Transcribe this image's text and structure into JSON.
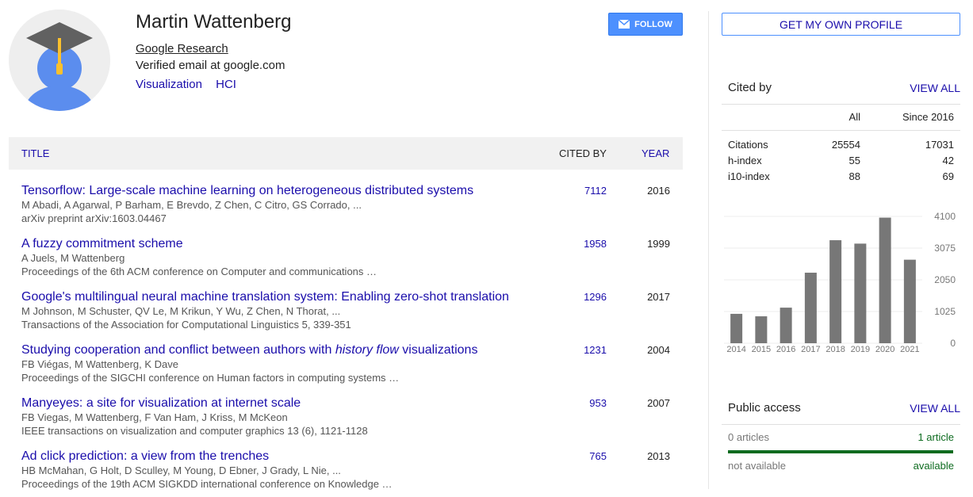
{
  "profile": {
    "name": "Martin Wattenberg",
    "affiliation": "Google Research",
    "email": "Verified email at google.com",
    "interests": [
      "Visualization",
      "HCI"
    ],
    "follow_label": "FOLLOW"
  },
  "table": {
    "headers": {
      "title": "TITLE",
      "cited_by": "CITED BY",
      "year": "YEAR"
    },
    "rows": [
      {
        "title": "Tensorflow: Large-scale machine learning on heterogeneous distributed systems",
        "authors": "M Abadi, A Agarwal, P Barham, E Brevdo, Z Chen, C Citro, GS Corrado, ...",
        "venue": "arXiv preprint arXiv:1603.04467",
        "cited": "7112",
        "year": "2016"
      },
      {
        "title": "A fuzzy commitment scheme",
        "authors": "A Juels, M Wattenberg",
        "venue": "Proceedings of the 6th ACM conference on Computer and communications …",
        "cited": "1958",
        "year": "1999"
      },
      {
        "title": "Google's multilingual neural machine translation system: Enabling zero-shot translation",
        "authors": "M Johnson, M Schuster, QV Le, M Krikun, Y Wu, Z Chen, N Thorat, ...",
        "venue": "Transactions of the Association for Computational Linguistics 5, 339-351",
        "cited": "1296",
        "year": "2017"
      },
      {
        "title_pre": "Studying cooperation and conflict between authors with ",
        "title_em": "history flow",
        "title_post": " visualizations",
        "authors": "FB Viégas, M Wattenberg, K Dave",
        "venue": "Proceedings of the SIGCHI conference on Human factors in computing systems …",
        "cited": "1231",
        "year": "2004"
      },
      {
        "title": "Manyeyes: a site for visualization at internet scale",
        "authors": "FB Viegas, M Wattenberg, F Van Ham, J Kriss, M McKeon",
        "venue": "IEEE transactions on visualization and computer graphics 13 (6), 1121-1128",
        "cited": "953",
        "year": "2007"
      },
      {
        "title": "Ad click prediction: a view from the trenches",
        "authors": "HB McMahan, G Holt, D Sculley, M Young, D Ebner, J Grady, L Nie, ...",
        "venue": "Proceedings of the 19th ACM SIGKDD international conference on Knowledge …",
        "cited": "765",
        "year": "2013"
      }
    ]
  },
  "sidebar": {
    "get_profile": "GET MY OWN PROFILE",
    "cited_by": {
      "title": "Cited by",
      "view_all": "VIEW ALL",
      "col_all": "All",
      "col_since": "Since 2016",
      "stats": [
        {
          "label": "Citations",
          "all": "25554",
          "since": "17031"
        },
        {
          "label": "h-index",
          "all": "55",
          "since": "42"
        },
        {
          "label": "i10-index",
          "all": "88",
          "since": "69"
        }
      ]
    },
    "public_access": {
      "title": "Public access",
      "view_all": "VIEW ALL",
      "left_count": "0 articles",
      "right_count": "1 article",
      "left_status": "not available",
      "right_status": "available"
    }
  },
  "chart_data": {
    "type": "bar",
    "categories": [
      "2014",
      "2015",
      "2016",
      "2017",
      "2018",
      "2019",
      "2020",
      "2021"
    ],
    "values": [
      950,
      870,
      1150,
      2280,
      3330,
      3220,
      4060,
      2700
    ],
    "yticks": [
      "4100",
      "3075",
      "2050",
      "1025",
      "0"
    ],
    "ylim": [
      0,
      4100
    ],
    "bar_color": "#777777"
  },
  "colors": {
    "link": "#1a0dab",
    "follow": "#4d90fe",
    "available": "#0d6b1f"
  }
}
